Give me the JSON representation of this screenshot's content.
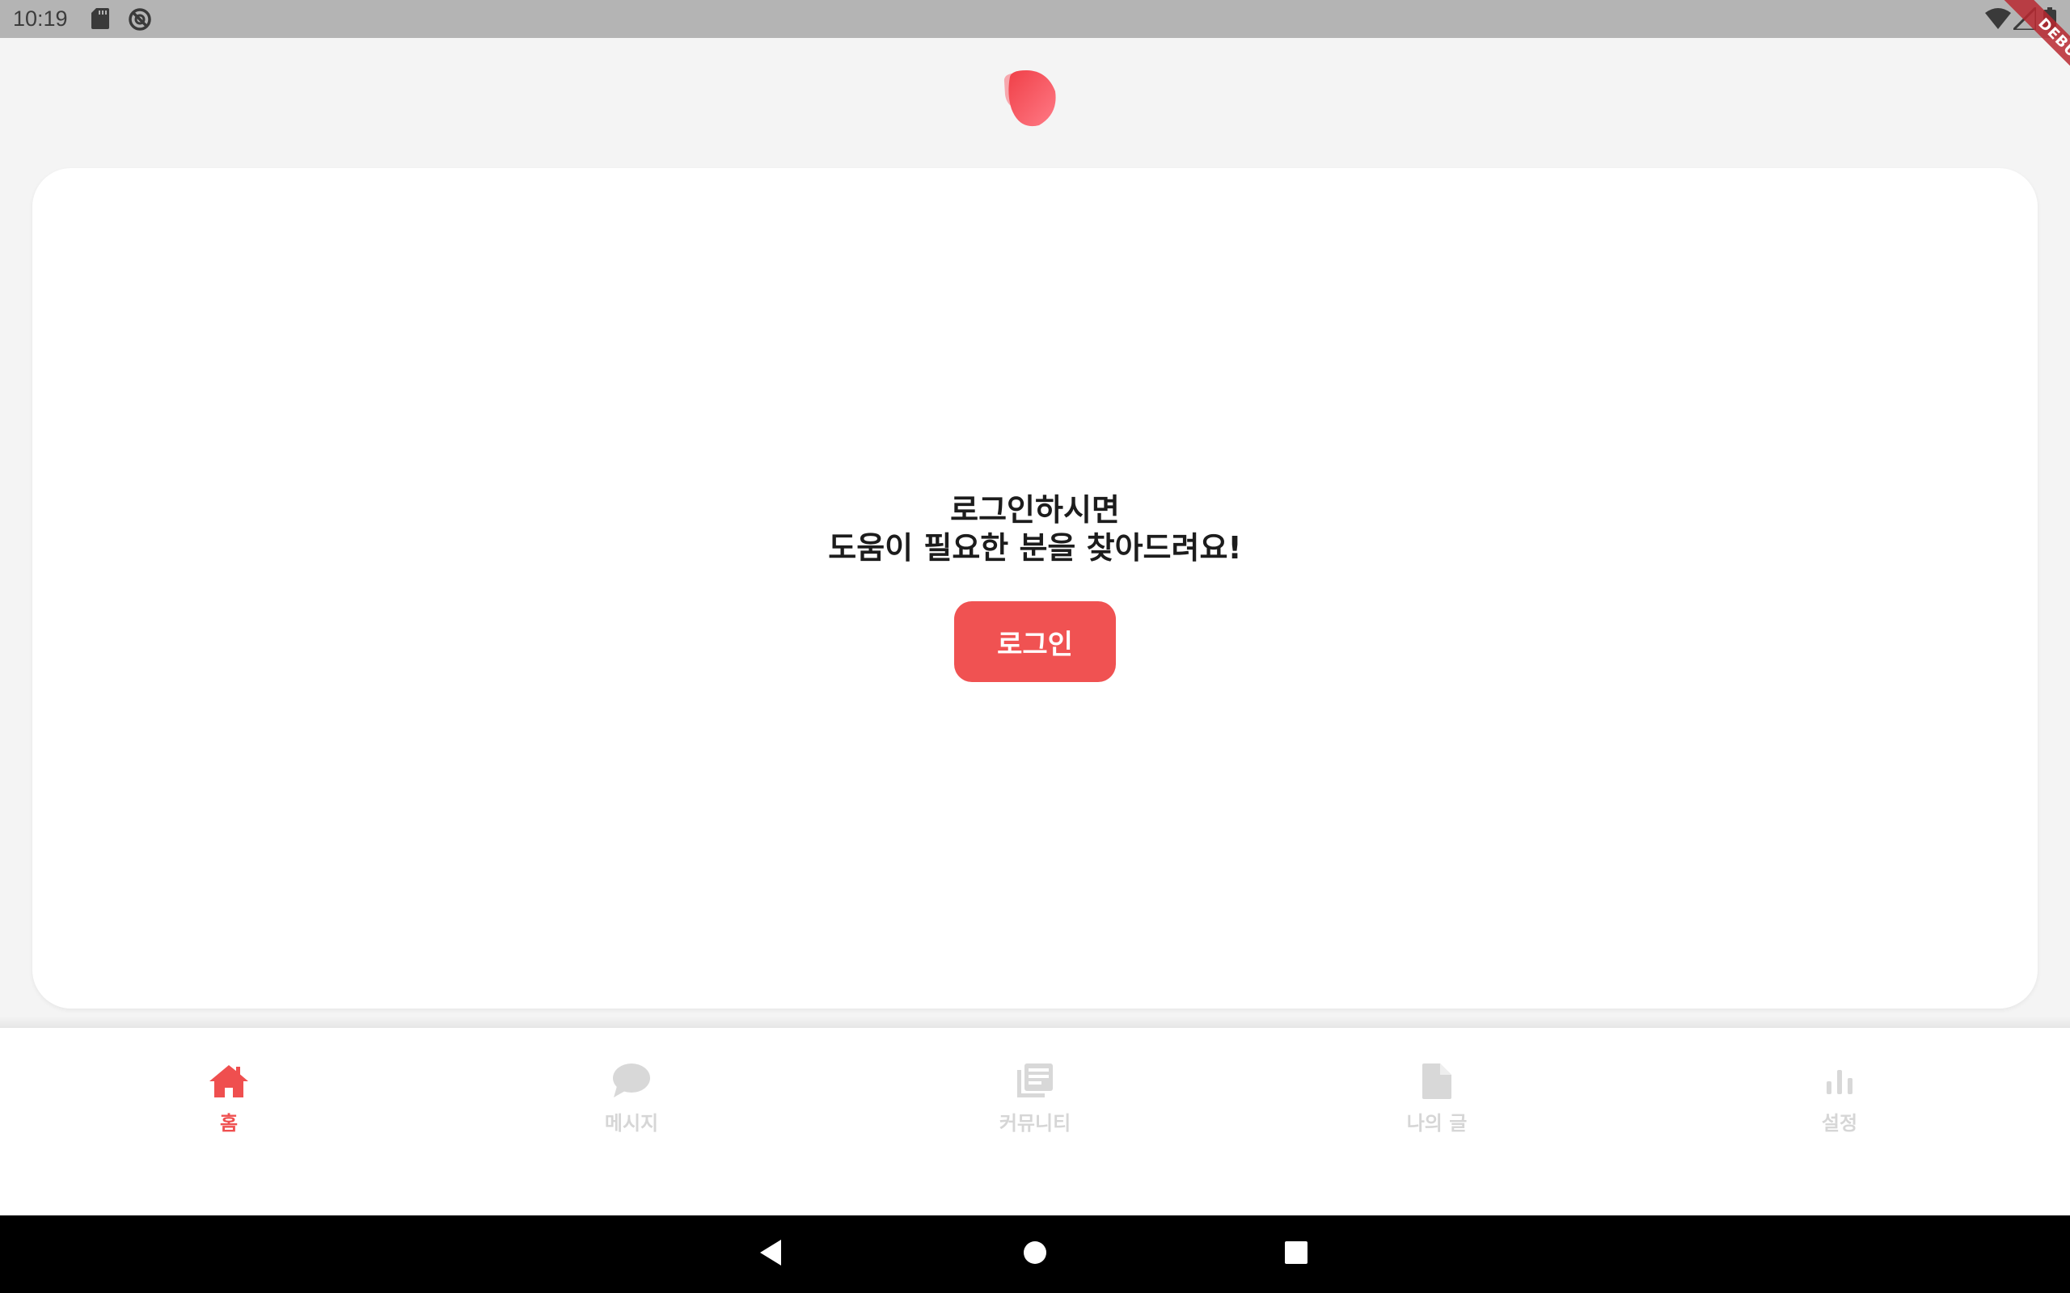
{
  "status_bar": {
    "time": "10:19",
    "icons": [
      "sd-card-icon",
      "do-not-disturb-icon",
      "wifi-icon",
      "signal-icon",
      "battery-icon"
    ]
  },
  "debug_banner": {
    "label": "DEBUG"
  },
  "header": {
    "logo_icon": "app-logo-icon"
  },
  "card": {
    "message_line1": "로그인하시면",
    "message_line2": "도움이 필요한 분을 찾아드려요!",
    "login_label": "로그인"
  },
  "bottom_nav": {
    "items": [
      {
        "label": "홈",
        "icon": "home-icon",
        "active": true
      },
      {
        "label": "메시지",
        "icon": "chat-bubble-icon",
        "active": false
      },
      {
        "label": "커뮤니티",
        "icon": "newspaper-icon",
        "active": false
      },
      {
        "label": "나의 글",
        "icon": "document-icon",
        "active": false
      },
      {
        "label": "설정",
        "icon": "bar-chart-icon",
        "active": false
      }
    ]
  },
  "colors": {
    "accent": "#f05252",
    "inactive": "#d6d6d6",
    "background": "#f4f4f4",
    "status_bar": "#b4b4b4"
  },
  "android_nav": {
    "buttons": [
      "back-icon",
      "home-circle-icon",
      "recents-icon"
    ]
  }
}
